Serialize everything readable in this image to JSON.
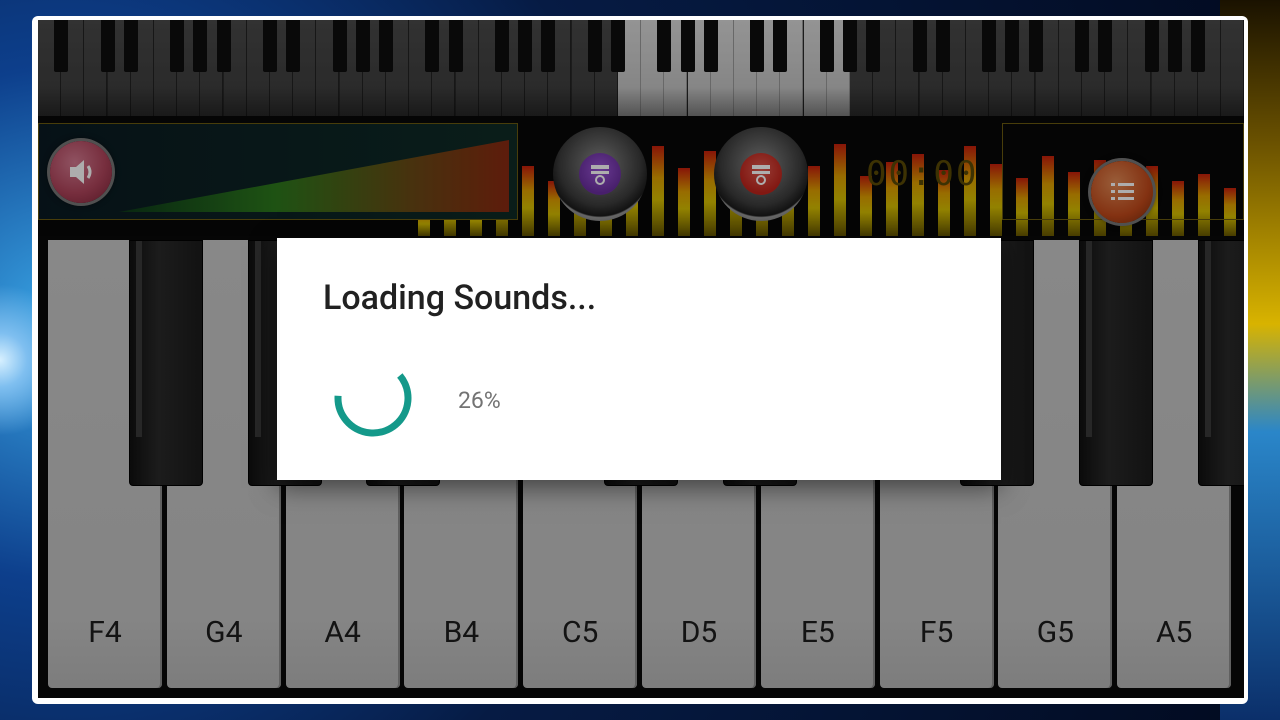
{
  "app": {
    "name": "Piano"
  },
  "dialog": {
    "title": "Loading Sounds...",
    "progress_label": "26%",
    "progress_value": 0.26
  },
  "toolbar": {
    "timer": "00:00",
    "volume_icon": "speaker-icon",
    "record_icon": "record-icon",
    "play_icon": "play-icon",
    "menu_icon": "menu-list-icon"
  },
  "piano": {
    "white_keys": [
      "F4",
      "G4",
      "A4",
      "B4",
      "C5",
      "D5",
      "E5",
      "F5",
      "G5",
      "A5"
    ]
  },
  "colors": {
    "spinner": "#14998a",
    "record_button": "#6b2fa0",
    "play_button": "#c0241b",
    "volume_button": "#b0455c",
    "menu_button": "#c24a1b"
  }
}
